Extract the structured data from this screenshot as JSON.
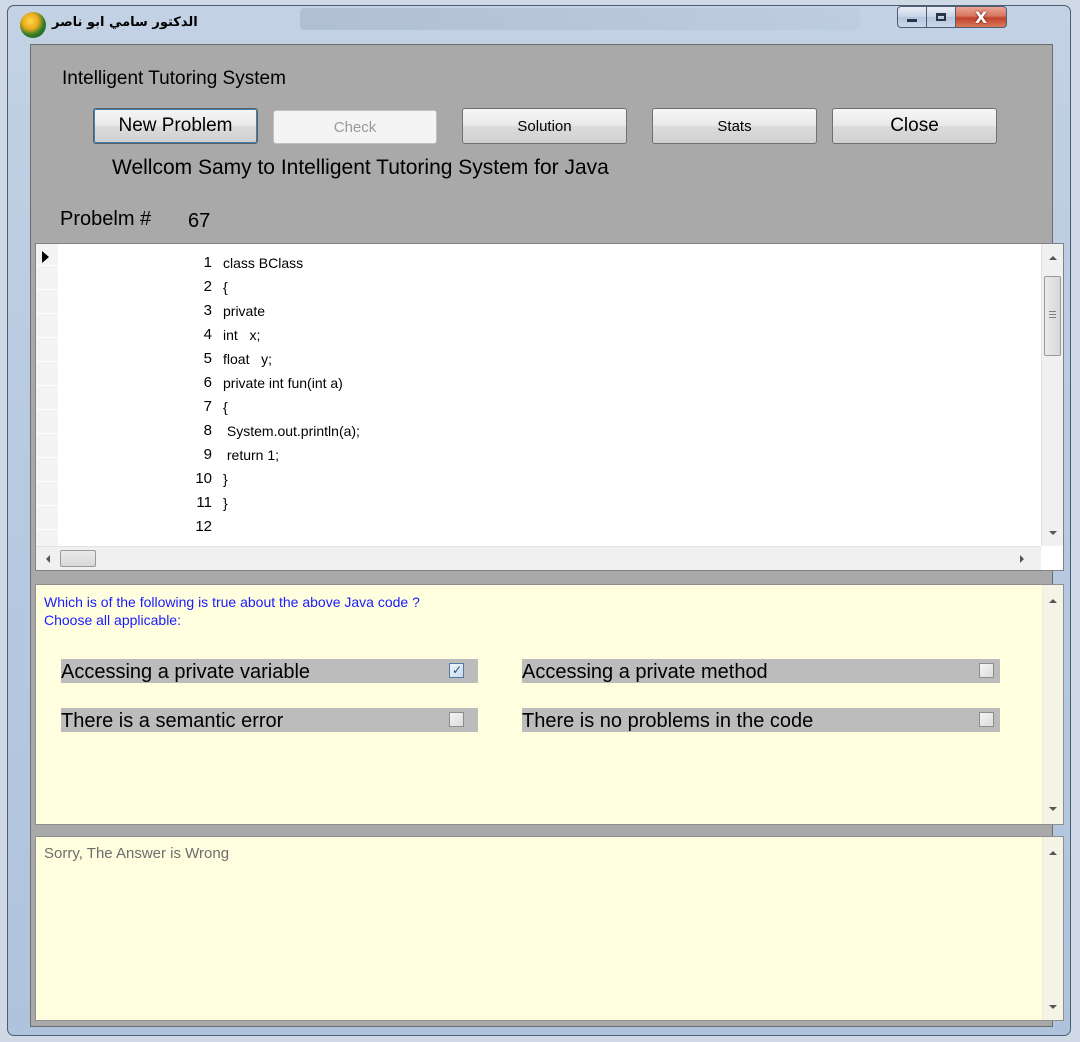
{
  "window": {
    "title": "الدكتور سامي ابو ناصر",
    "icon": "app-logo-icon",
    "close_glyph": "X"
  },
  "header": {
    "heading": "Intelligent Tutoring System",
    "welcome": "Wellcom Samy  to  Intelligent Tutoring System for Java",
    "problem_label": "Probelm #",
    "problem_number": "67"
  },
  "toolbar": {
    "new_problem": "New Problem",
    "check": "Check",
    "solution": "Solution",
    "stats": "Stats",
    "close": "Close"
  },
  "code": {
    "lines": [
      {
        "n": "1",
        "text": "class BClass"
      },
      {
        "n": "2",
        "text": "{"
      },
      {
        "n": "3",
        "text": "private"
      },
      {
        "n": "4",
        "text": "int   x;"
      },
      {
        "n": "5",
        "text": "float   y;"
      },
      {
        "n": "6",
        "text": "private int fun(int a)"
      },
      {
        "n": "7",
        "text": "{"
      },
      {
        "n": "8",
        "text": " System.out.println(a);"
      },
      {
        "n": "9",
        "text": " return 1;"
      },
      {
        "n": "10",
        "text": "}"
      },
      {
        "n": "11",
        "text": "}"
      },
      {
        "n": "12",
        "text": ""
      }
    ]
  },
  "question": {
    "line1": "Which is of the following is true about the above Java code ?",
    "line2": "Choose all applicable:",
    "options": [
      {
        "label": "Accessing a private variable",
        "checked": true
      },
      {
        "label": "Accessing a private method",
        "checked": false
      },
      {
        "label": "There is a semantic error",
        "checked": false
      },
      {
        "label": "There is no problems in the code",
        "checked": false
      }
    ]
  },
  "feedback": {
    "text": "Sorry, The Answer is Wrong"
  },
  "colors": {
    "question_text": "#1a1aff",
    "panel_background": "#ffffe0",
    "client_background": "#a9a9a9",
    "option_background": "#bcbcbc"
  }
}
